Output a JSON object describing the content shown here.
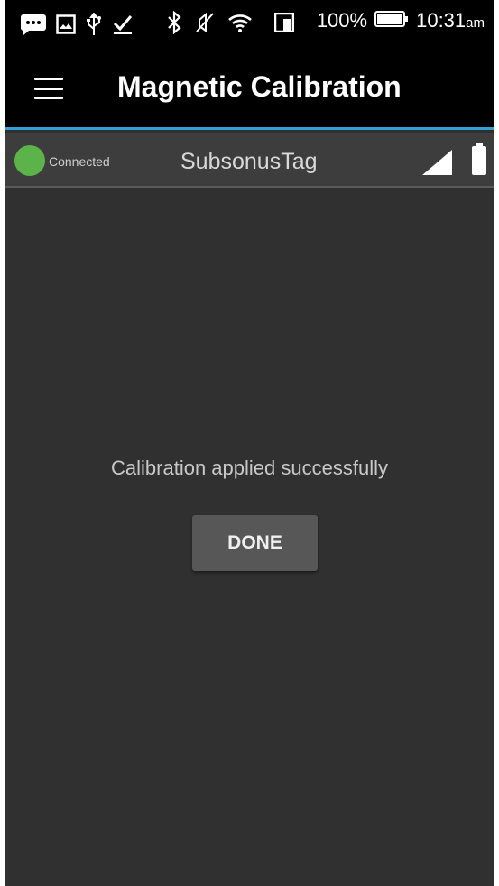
{
  "status_bar": {
    "battery_percent": "100%",
    "time": "10:31",
    "time_suffix": "am",
    "icons": [
      "message-icon",
      "image-icon",
      "usb-icon",
      "download-done-icon",
      "bluetooth-icon",
      "mute-icon",
      "wifi-icon",
      "nfc-icon",
      "battery-icon"
    ]
  },
  "app_bar": {
    "title": "Magnetic Calibration"
  },
  "device": {
    "status": "Connected",
    "name": "SubsonusTag",
    "status_color": "#5cb34a"
  },
  "content": {
    "message": "Calibration applied successfully",
    "done_label": "DONE"
  },
  "colors": {
    "accent": "#33a0d8",
    "background": "#303030"
  }
}
